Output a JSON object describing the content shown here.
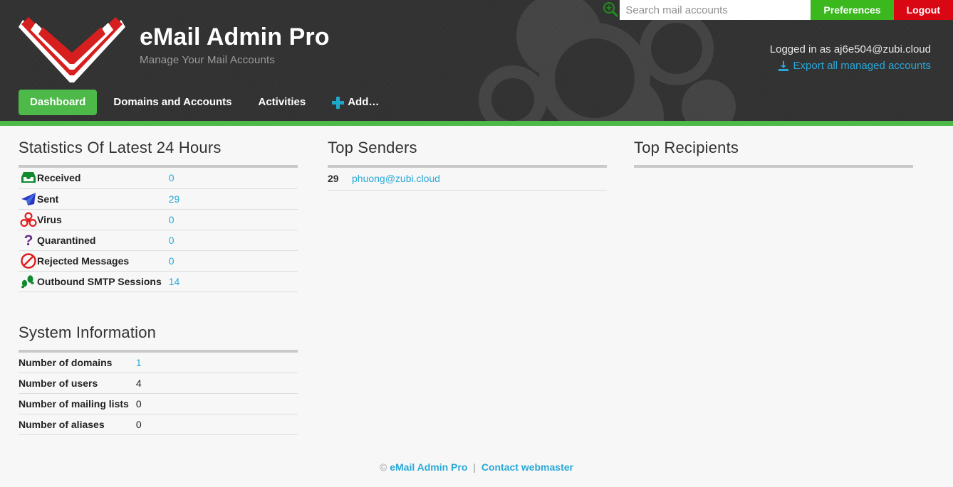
{
  "brand": {
    "title": "eMail Admin Pro",
    "subtitle": "Manage Your Mail Accounts",
    "logo_icon": "envelope-logo-icon"
  },
  "topbar": {
    "search_placeholder": "Search mail accounts",
    "search_value": "",
    "search_icon": "search-zoom-in-icon",
    "preferences_label": "Preferences",
    "logout_label": "Logout",
    "preferences_color": "#3bb81e",
    "logout_color": "#d90613"
  },
  "user": {
    "logged_in_text": "Logged in as aj6e504@zubi.cloud",
    "export_label": "Export all managed accounts",
    "export_icon": "download-icon",
    "link_color": "#29a8d8"
  },
  "nav": {
    "items": [
      {
        "label": "Dashboard",
        "active": true,
        "icon": ""
      },
      {
        "label": "Domains and Accounts",
        "active": false,
        "icon": ""
      },
      {
        "label": "Activities",
        "active": false,
        "icon": ""
      },
      {
        "label": "Add…",
        "active": false,
        "icon": "plus-icon"
      }
    ],
    "active_color": "#4cb949",
    "accent_color": "#1fa8c9"
  },
  "statistics": {
    "title": "Statistics Of Latest 24 Hours",
    "rows": [
      {
        "icon": "inbox-tray-icon",
        "label": "Received",
        "value": "0"
      },
      {
        "icon": "paper-plane-icon",
        "label": "Sent",
        "value": "29"
      },
      {
        "icon": "biohazard-icon",
        "label": "Virus",
        "value": "0"
      },
      {
        "icon": "question-mark-icon",
        "label": "Quarantined",
        "value": "0"
      },
      {
        "icon": "no-entry-icon",
        "label": "Rejected Messages",
        "value": "0"
      },
      {
        "icon": "footprints-icon",
        "label": "Outbound SMTP Sessions",
        "value": "14"
      }
    ]
  },
  "system_information": {
    "title": "System Information",
    "rows": [
      {
        "label": "Number of domains",
        "value": "1",
        "link": true
      },
      {
        "label": "Number of users",
        "value": "4",
        "link": false
      },
      {
        "label": "Number of mailing lists",
        "value": "0",
        "link": false
      },
      {
        "label": "Number of aliases",
        "value": "0",
        "link": false
      }
    ]
  },
  "top_senders": {
    "title": "Top Senders",
    "rows": [
      {
        "count": "29",
        "address": "phuong@zubi.cloud"
      }
    ]
  },
  "top_recipients": {
    "title": "Top Recipients",
    "rows": []
  },
  "footer": {
    "copyright_symbol": "©",
    "product": "eMail Admin Pro",
    "separator": "|",
    "contact_label": "Contact webmaster"
  }
}
